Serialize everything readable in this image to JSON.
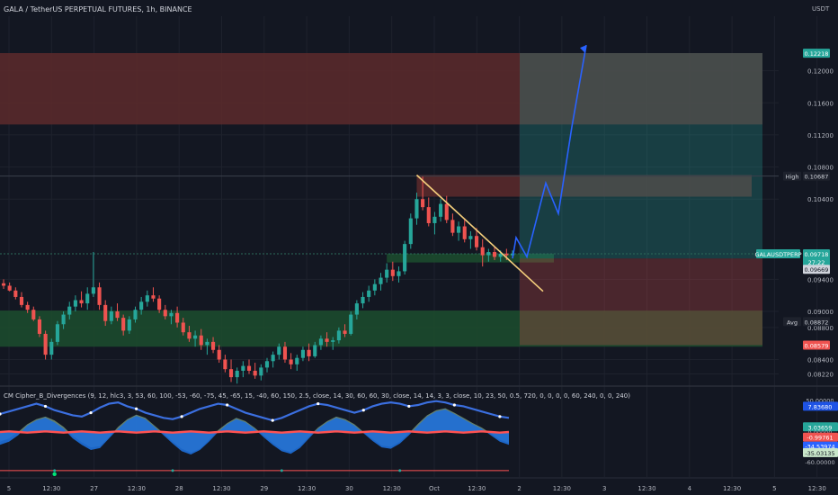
{
  "header": {
    "title": "GALA / TetherUS PERPETUAL FUTURES, 1h, BINANCE",
    "currency": "USDT"
  },
  "colors": {
    "background": "#131722",
    "grid": "#1e222d",
    "axis_text": "#b2b5be",
    "candle_up": "#26a69a",
    "candle_down": "#ef5350",
    "red_zone": "#5d2a2c",
    "green_zone": "#1c4a2e",
    "trendline": "#f5cf7c",
    "projection": "#2962ff",
    "wave_blue": "#1e6fd9",
    "wave_light": "#a5d6a7",
    "wave_red": "#ff5252"
  },
  "chart_data": [
    {
      "type": "candlestick",
      "title": "GALA / TetherUS PERPETUAL FUTURES, 1h, BINANCE",
      "series_name": "GALAUSDTPERP",
      "price_axis": {
        "label": "USDT",
        "ylim": [
          0.0808,
          0.1268
        ],
        "ticks": [
          "0.12000",
          "0.11600",
          "0.11200",
          "0.10800",
          "0.10400",
          "0.09400",
          "0.09000",
          "0.08800",
          "0.08400",
          "0.08220"
        ]
      },
      "time_axis": {
        "ticks": [
          "5",
          "12:30",
          "27",
          "12:30",
          "28",
          "12:30",
          "29",
          "12:30",
          "30",
          "12:30",
          "Oct",
          "12:30",
          "2",
          "12:30",
          "3",
          "12:30",
          "4",
          "12:30",
          "5",
          "12:30"
        ]
      },
      "price_labels": [
        {
          "text": "0.12218",
          "value": 0.12218,
          "kind": "green"
        },
        {
          "text": "High",
          "value": 0.10687,
          "kind": "tag"
        },
        {
          "text": "0.10687",
          "value": 0.10687,
          "kind": "dark"
        },
        {
          "text": "GALAUSDTPERP",
          "value": 0.09718,
          "kind": "tag-green"
        },
        {
          "text": "0.09718",
          "value": 0.09718,
          "kind": "green"
        },
        {
          "text": "27:22",
          "value": 0.09618,
          "kind": "green-sub"
        },
        {
          "text": "0.09669",
          "value": 0.09525,
          "kind": "light"
        },
        {
          "text": "Avg",
          "value": 0.08872,
          "kind": "tag"
        },
        {
          "text": "0.08872",
          "value": 0.08872,
          "kind": "dark"
        },
        {
          "text": "0.08579",
          "value": 0.08579,
          "kind": "red"
        }
      ],
      "zones": [
        {
          "name": "resistance-zone",
          "from": 0.1133,
          "to": 0.1222
        },
        {
          "name": "support-zone",
          "from": 0.0856,
          "to": 0.0901
        },
        {
          "name": "local-resistance-box",
          "from": 0.1043,
          "to": 0.107
        },
        {
          "name": "local-support-box",
          "from": 0.0961,
          "to": 0.0972
        }
      ],
      "position_tool": {
        "entry": 0.0966,
        "target": 0.1222,
        "stop": 0.0858
      },
      "candles": [
        [
          0.0935,
          0.094,
          0.0928,
          0.0932
        ],
        [
          0.0932,
          0.0936,
          0.0925,
          0.0926
        ],
        [
          0.0926,
          0.093,
          0.0915,
          0.0918
        ],
        [
          0.0918,
          0.0924,
          0.0905,
          0.0908
        ],
        [
          0.0908,
          0.0912,
          0.0898,
          0.0902
        ],
        [
          0.0902,
          0.0906,
          0.0888,
          0.089
        ],
        [
          0.089,
          0.0894,
          0.0868,
          0.0872
        ],
        [
          0.0872,
          0.0876,
          0.084,
          0.0846
        ],
        [
          0.0846,
          0.0866,
          0.084,
          0.0862
        ],
        [
          0.0862,
          0.0888,
          0.0858,
          0.0884
        ],
        [
          0.0884,
          0.09,
          0.0878,
          0.0896
        ],
        [
          0.0896,
          0.0912,
          0.089,
          0.0906
        ],
        [
          0.0906,
          0.092,
          0.09,
          0.0914
        ],
        [
          0.0914,
          0.0925,
          0.0905,
          0.091
        ],
        [
          0.091,
          0.093,
          0.0902,
          0.0922
        ],
        [
          0.0922,
          0.0974,
          0.0918,
          0.093
        ],
        [
          0.093,
          0.0936,
          0.0902,
          0.0908
        ],
        [
          0.0908,
          0.0914,
          0.0882,
          0.0888
        ],
        [
          0.0888,
          0.0906,
          0.0884,
          0.09
        ],
        [
          0.09,
          0.091,
          0.0888,
          0.0892
        ],
        [
          0.0892,
          0.0896,
          0.087,
          0.0876
        ],
        [
          0.0876,
          0.0894,
          0.0872,
          0.089
        ],
        [
          0.089,
          0.0906,
          0.0886,
          0.0902
        ],
        [
          0.0902,
          0.0918,
          0.0896,
          0.0912
        ],
        [
          0.0912,
          0.0926,
          0.0906,
          0.092
        ],
        [
          0.092,
          0.093,
          0.0912,
          0.0916
        ],
        [
          0.0916,
          0.092,
          0.0898,
          0.0902
        ],
        [
          0.0902,
          0.0908,
          0.089,
          0.0894
        ],
        [
          0.0894,
          0.0902,
          0.0884,
          0.0898
        ],
        [
          0.0898,
          0.0906,
          0.088,
          0.0886
        ],
        [
          0.0886,
          0.0892,
          0.087,
          0.0874
        ],
        [
          0.0874,
          0.0882,
          0.0862,
          0.0866
        ],
        [
          0.0866,
          0.0876,
          0.0856,
          0.087
        ],
        [
          0.087,
          0.0878,
          0.0852,
          0.0858
        ],
        [
          0.0858,
          0.0866,
          0.0846,
          0.0862
        ],
        [
          0.0862,
          0.0868,
          0.0848,
          0.0852
        ],
        [
          0.0852,
          0.0858,
          0.0836,
          0.084
        ],
        [
          0.084,
          0.0846,
          0.0824,
          0.0828
        ],
        [
          0.0828,
          0.084,
          0.0812,
          0.0818
        ],
        [
          0.0818,
          0.083,
          0.081,
          0.0826
        ],
        [
          0.0826,
          0.0838,
          0.0818,
          0.0832
        ],
        [
          0.0832,
          0.084,
          0.0822,
          0.0826
        ],
        [
          0.0826,
          0.0836,
          0.0816,
          0.082
        ],
        [
          0.082,
          0.0834,
          0.0814,
          0.083
        ],
        [
          0.083,
          0.0842,
          0.0824,
          0.0838
        ],
        [
          0.0838,
          0.085,
          0.083,
          0.0846
        ],
        [
          0.0846,
          0.086,
          0.084,
          0.0856
        ],
        [
          0.0856,
          0.0862,
          0.0836,
          0.084
        ],
        [
          0.084,
          0.0848,
          0.0828,
          0.0834
        ],
        [
          0.0834,
          0.0846,
          0.0826,
          0.0842
        ],
        [
          0.0842,
          0.0856,
          0.0838,
          0.0852
        ],
        [
          0.0852,
          0.086,
          0.0838,
          0.0844
        ],
        [
          0.0844,
          0.0862,
          0.0842,
          0.0858
        ],
        [
          0.0858,
          0.087,
          0.0852,
          0.0866
        ],
        [
          0.0866,
          0.0874,
          0.0856,
          0.0862
        ],
        [
          0.0862,
          0.0868,
          0.0852,
          0.0864
        ],
        [
          0.0864,
          0.088,
          0.086,
          0.0876
        ],
        [
          0.0876,
          0.0884,
          0.0868,
          0.0872
        ],
        [
          0.0872,
          0.09,
          0.087,
          0.0896
        ],
        [
          0.0896,
          0.0914,
          0.089,
          0.091
        ],
        [
          0.091,
          0.0924,
          0.0904,
          0.0918
        ],
        [
          0.0918,
          0.0932,
          0.0912,
          0.0926
        ],
        [
          0.0926,
          0.094,
          0.092,
          0.0934
        ],
        [
          0.0934,
          0.0948,
          0.0926,
          0.0942
        ],
        [
          0.0942,
          0.096,
          0.0936,
          0.0952
        ],
        [
          0.0952,
          0.0962,
          0.0938,
          0.0944
        ],
        [
          0.0944,
          0.0956,
          0.0936,
          0.095
        ],
        [
          0.095,
          0.0988,
          0.0946,
          0.0984
        ],
        [
          0.0984,
          0.1022,
          0.0978,
          0.1016
        ],
        [
          0.1016,
          0.1048,
          0.1008,
          0.104
        ],
        [
          0.104,
          0.1068,
          0.1026,
          0.103
        ],
        [
          0.103,
          0.1042,
          0.1006,
          0.101
        ],
        [
          0.101,
          0.1024,
          0.0996,
          0.1018
        ],
        [
          0.1018,
          0.104,
          0.1012,
          0.1034
        ],
        [
          0.1034,
          0.1044,
          0.101,
          0.1014
        ],
        [
          0.1014,
          0.1022,
          0.0994,
          0.0998
        ],
        [
          0.0998,
          0.1012,
          0.0988,
          0.1006
        ],
        [
          0.1006,
          0.1016,
          0.0986,
          0.099
        ],
        [
          0.099,
          0.1,
          0.0978,
          0.0994
        ],
        [
          0.0994,
          0.1004,
          0.0976,
          0.098
        ],
        [
          0.098,
          0.099,
          0.0956,
          0.097
        ],
        [
          0.097,
          0.0978,
          0.0962,
          0.0974
        ],
        [
          0.0974,
          0.098,
          0.0964,
          0.0968
        ],
        [
          0.0968,
          0.0976,
          0.0962,
          0.0972
        ],
        [
          0.0972,
          0.0978,
          0.0964,
          0.097
        ],
        [
          0.097,
          0.0976,
          0.0966,
          0.0972
        ]
      ],
      "trendline": [
        [
          0.107,
          0
        ],
        [
          0.0925,
          1
        ]
      ],
      "projection": [
        0.0966,
        0.0992,
        0.0968,
        0.106,
        0.1022,
        0.113,
        0.1232
      ]
    },
    {
      "type": "line",
      "title": "CM Cipher_B_Divergences (9, 12, hlc3, 3, 53, 60, 100, -53, -60, -75, 45, -65, 15, -40, 60, 150, 2.5, close, 14, 30, 60, 60, 30, close, 14, 14, 3, 3, close, 10, 23, 50, 0.5, 720, 0, 0, 0, 0, 60, 240, 0, 0, 240)",
      "ylim": [
        -70,
        70
      ],
      "value_labels": [
        {
          "text": "50.00000",
          "value": 50,
          "kind": "plain"
        },
        {
          "text": "7.83680",
          "value": 40,
          "kind": "blue"
        },
        {
          "text": "3.03659",
          "value": 8,
          "kind": "green"
        },
        {
          "text": "0.00000",
          "value": 0,
          "kind": "plain"
        },
        {
          "text": "-0.99761",
          "value": -8,
          "kind": "red"
        },
        {
          "text": "-34.53974",
          "value": -22,
          "kind": "navy"
        },
        {
          "text": "-35.03135",
          "value": -32,
          "kind": "light"
        },
        {
          "text": "-60.00000",
          "value": -46,
          "kind": "plain"
        }
      ],
      "series": [
        {
          "values": [
            -20,
            -15,
            -5,
            10,
            18,
            22,
            15,
            5,
            -10,
            -20,
            -28,
            -25,
            -10,
            5,
            18,
            25,
            20,
            8,
            -5,
            -18,
            -30,
            -35,
            -28,
            -15,
            0,
            12,
            20,
            15,
            5,
            -8,
            -20,
            -30,
            -34,
            -25,
            -10,
            5,
            15,
            22,
            18,
            10,
            -2,
            -14,
            -24,
            -26,
            -18,
            -5,
            10,
            24,
            32,
            35,
            28,
            20,
            12,
            5,
            -5,
            -15,
            -20
          ]
        },
        {
          "values": [
            -15,
            -10,
            0,
            12,
            20,
            24,
            18,
            8,
            -6,
            -16,
            -24,
            -22,
            -8,
            8,
            20,
            27,
            22,
            10,
            -2,
            -15,
            -26,
            -32,
            -26,
            -12,
            3,
            14,
            22,
            17,
            7,
            -5,
            -17,
            -27,
            -31,
            -22,
            -7,
            7,
            17,
            24,
            20,
            12,
            0,
            -11,
            -21,
            -23,
            -15,
            -2,
            13,
            26,
            34,
            37,
            30,
            22,
            14,
            7,
            -2,
            -12,
            -17
          ]
        },
        {
          "values": [
            28,
            32,
            36,
            40,
            44,
            40,
            34,
            30,
            26,
            24,
            30,
            38,
            44,
            46,
            40,
            36,
            30,
            26,
            22,
            20,
            24,
            30,
            36,
            40,
            44,
            42,
            36,
            30,
            26,
            22,
            18,
            22,
            28,
            34,
            40,
            44,
            42,
            38,
            34,
            30,
            34,
            40,
            44,
            46,
            44,
            40,
            42,
            46,
            48,
            46,
            42,
            40,
            36,
            32,
            28,
            24,
            22
          ]
        },
        {
          "values": [
            0,
            1,
            0,
            -1,
            0,
            1,
            0,
            -1,
            0,
            1,
            0,
            -1,
            0,
            1,
            0,
            -1,
            0,
            1,
            0,
            -1,
            0,
            1,
            0,
            -1,
            0,
            1,
            0,
            -1,
            0,
            1,
            0,
            -1,
            0,
            1,
            0,
            -1,
            0,
            1,
            0,
            -1,
            0,
            1,
            0,
            -1,
            0,
            1,
            0,
            -1,
            0,
            1,
            0,
            -1,
            0,
            1,
            0,
            -1,
            0
          ]
        }
      ]
    }
  ]
}
